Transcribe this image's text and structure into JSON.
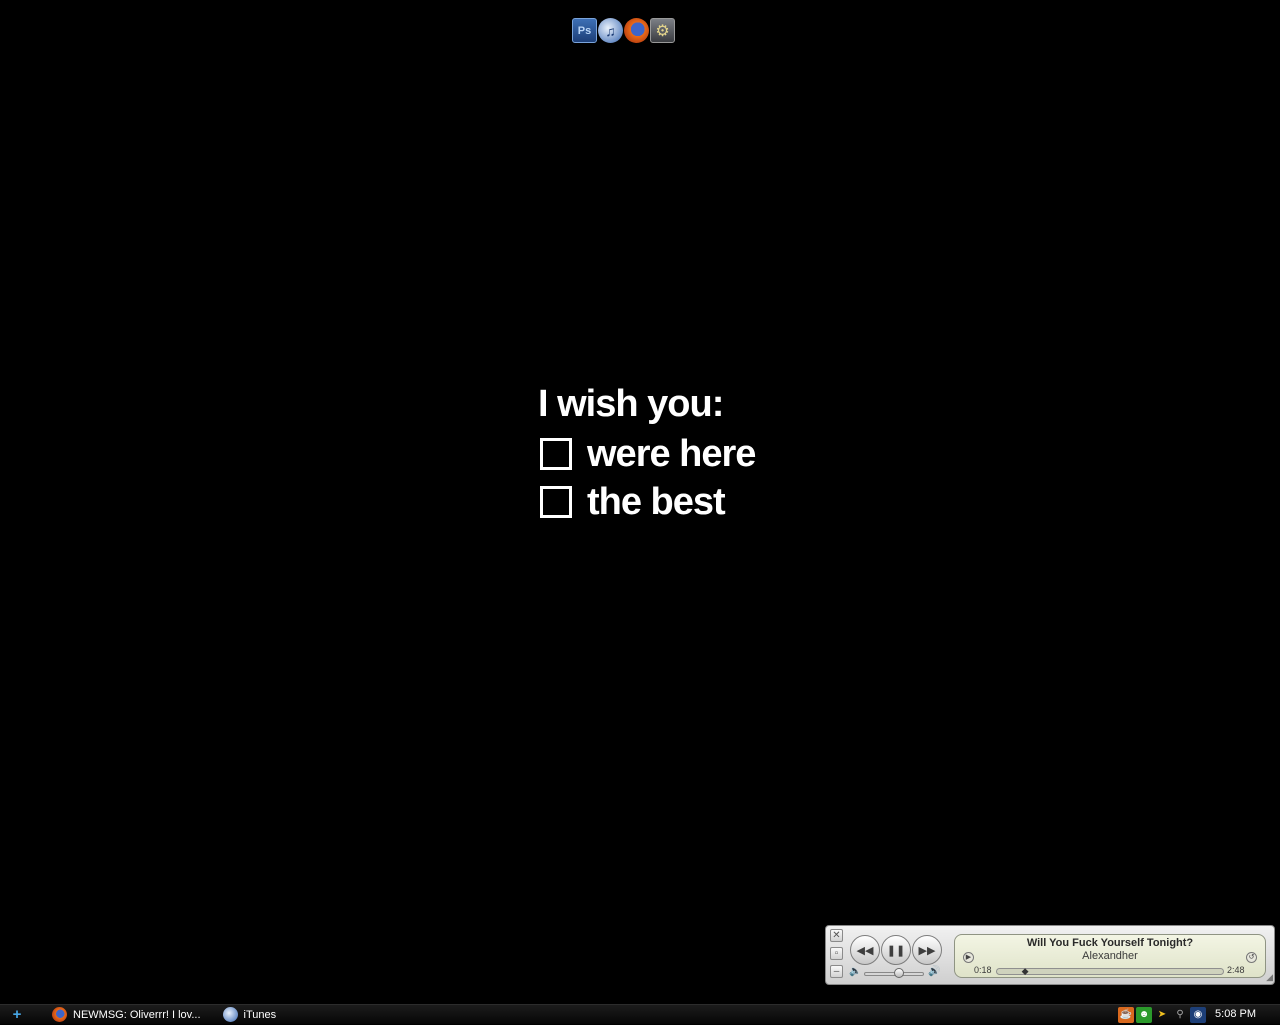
{
  "dock": {
    "items": [
      {
        "name": "Photoshop",
        "glyph": "Ps"
      },
      {
        "name": "iTunes",
        "glyph": "♫"
      },
      {
        "name": "Firefox",
        "glyph": ""
      },
      {
        "name": "Settings",
        "glyph": ""
      }
    ]
  },
  "wallpaper": {
    "title": "I wish you:",
    "options": [
      "were here",
      "the best"
    ]
  },
  "mini_player": {
    "track_title": "Will You Fuck Yourself Tonight?",
    "artist": "Alexandher",
    "elapsed": "0:18",
    "duration": "2:48",
    "progress_fraction": 0.107,
    "volume_fraction": 0.6,
    "state": "playing"
  },
  "taskbar": {
    "start_glyph": "+",
    "tasks": [
      {
        "label": "NEWMSG: Oliverrr! I lov...",
        "app": "Firefox"
      },
      {
        "label": "iTunes",
        "app": "iTunes"
      }
    ],
    "tray_icons": [
      "java-icon",
      "messenger-icon",
      "arrows-icon",
      "network-icon",
      "wireless-icon"
    ],
    "clock": "5:08 PM"
  },
  "colors": {
    "desktop": "#000000",
    "wallpaper_text": "#ffffff",
    "taskbar": "#0d0d0d",
    "start_accent": "#47a7e6"
  }
}
